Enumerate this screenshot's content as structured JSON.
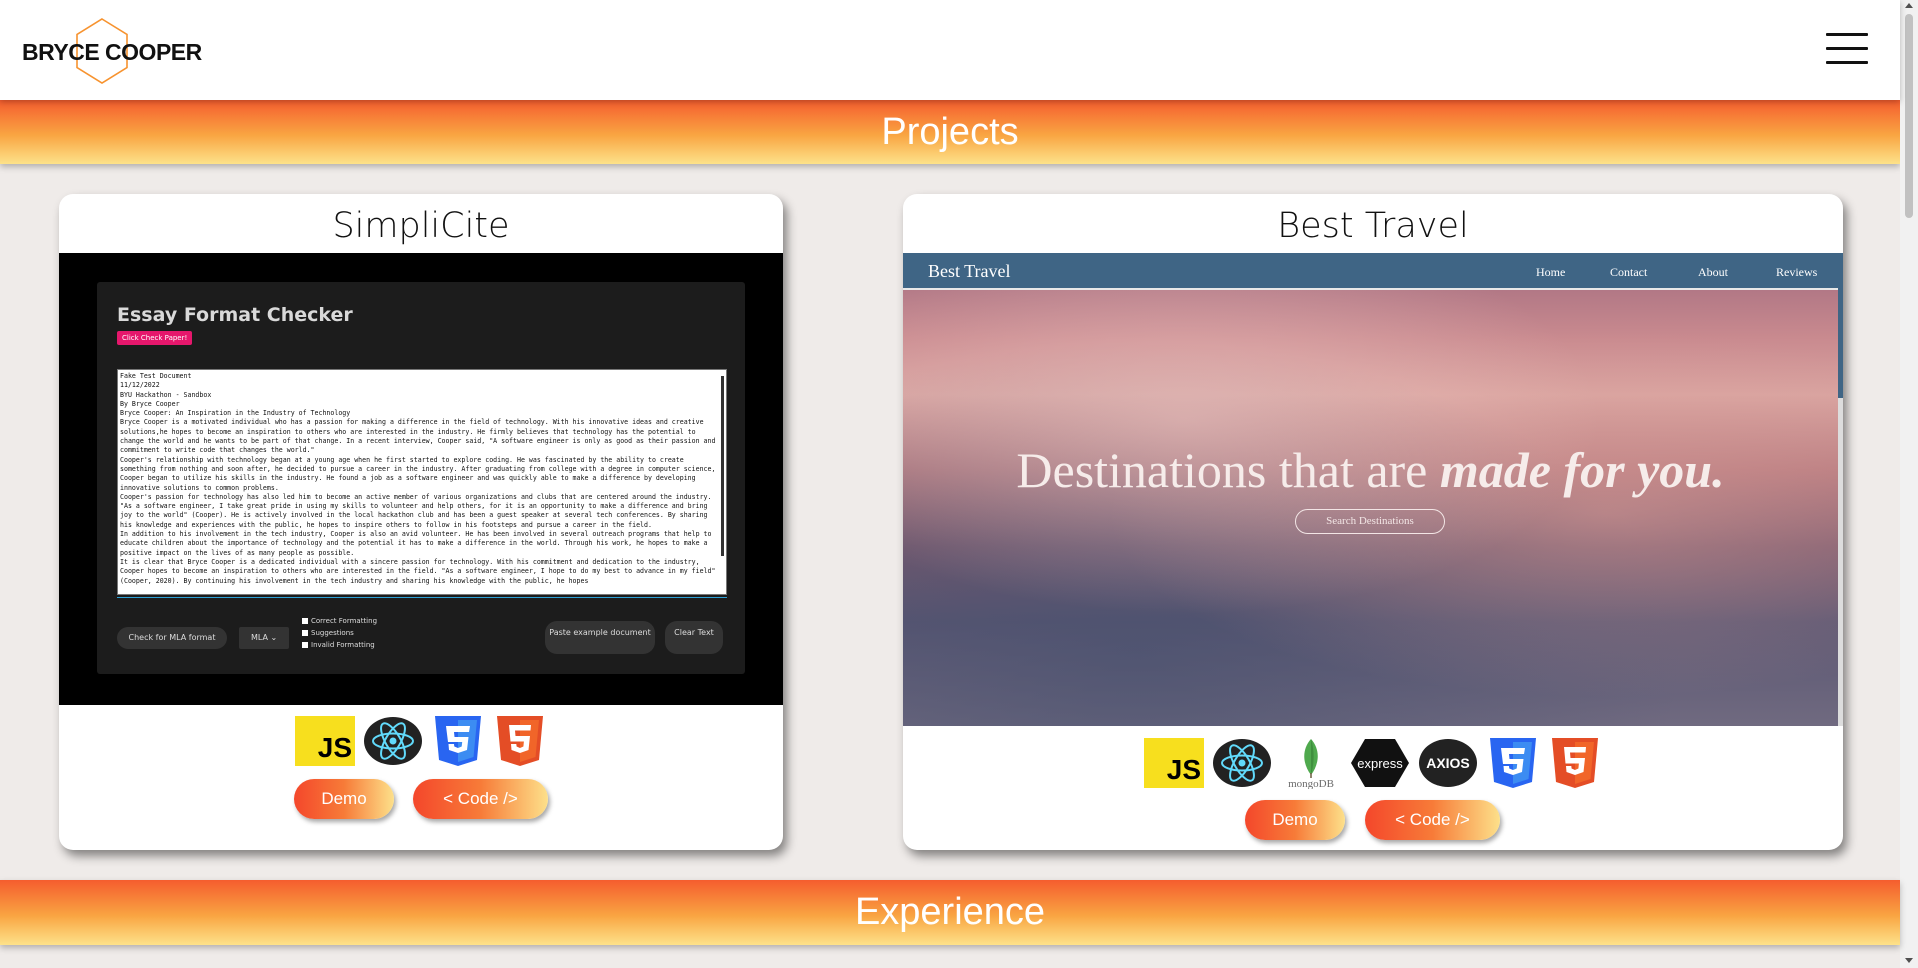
{
  "header": {
    "logo_text": "BRYCE COOPER",
    "menu_icon": "hamburger-menu-icon"
  },
  "sections": {
    "projects": "Projects",
    "experience": "Experience"
  },
  "projects": [
    {
      "title": "SimpliCite",
      "preview": {
        "heading": "Essay Format Checker",
        "check_button": "Click Check Paper!",
        "essay_text": "Fake Test Document\n11/12/2022\nBYU Hackathon - Sandbox\nBy Bryce Cooper\nBryce Cooper: An Inspiration in the Industry of Technology\nBryce Cooper is a motivated individual who has a passion for making a difference in the field of technology. With his innovative ideas and creative solutions,he hopes to become an inspiration to others who are interested in the industry. He firmly believes that technology has the potential to change the world and he wants to be part of that change. In a recent interview, Cooper said, \"A software engineer is only as good as their passion and commitment to write code that changes the world.\"\nCooper's relationship with technology began at a young age when he first started to explore coding. He was fascinated by the ability to create something from nothing and soon after, he decided to pursue a career in the industry. After graduating from college with a degree in computer science, Cooper began to utilize his skills in the industry. He found a job as a software engineer and was quickly able to make a difference by developing innovative solutions to common problems.\nCooper's passion for technology has also led him to become an active member of various organizations and clubs that are centered around the industry. \"As a software engineer, I take great pride in using my skills to volunteer and help others, for it is an opportunity to make a difference and bring joy to the world\" (Cooper). He is actively involved in the local hackathon club and has been a guest speaker at several tech conferences. By sharing his knowledge and experiences with the public, he hopes to inspire others to follow in his footsteps and pursue a career in the field.\nIn addition to his involvement in the tech industry, Cooper is also an avid volunteer. He has been involved in several outreach programs that help to educate children about the importance of technology and the potential it has to make a difference in the world. Through his work, he hopes to make a positive impact on the lives of as many people as possible.\nIt is clear that Bryce Cooper is a dedicated individual with a sincere passion for technology. With his commitment and dedication to the industry, Cooper hopes to become an inspiration to others who are interested in the field. \"As a software engineer, I hope to do my best to advance in my field\" (Cooper, 2020). By continuing his involvement in the tech industry and sharing his knowledge with the public, he hopes",
        "mla_button": "Check for MLA format",
        "format_select": "MLA",
        "checks": [
          "Correct Formatting",
          "Suggestions",
          "Invalid Formatting"
        ],
        "paste_button": "Paste example document",
        "clear_button": "Clear Text"
      },
      "tech_icons": [
        "javascript-icon",
        "react-icon",
        "css3-icon",
        "html5-icon"
      ],
      "demo_label": "Demo",
      "code_label": "< Code />"
    },
    {
      "title": "Best Travel",
      "preview": {
        "brand": "Best Travel",
        "nav": [
          "Home",
          "Contact",
          "About",
          "Reviews"
        ],
        "hero_plain": "Destinations that are ",
        "hero_emphasis": "made for you.",
        "search_button": "Search Destinations"
      },
      "tech_icons": [
        "javascript-icon",
        "react-icon",
        "mongodb-icon",
        "express-icon",
        "axios-icon",
        "css3-icon",
        "html5-icon"
      ],
      "tech_labels": {
        "mongodb": "mongoDB",
        "express": "express",
        "axios": "AXIOS"
      },
      "demo_label": "Demo",
      "code_label": "< Code />"
    }
  ],
  "colors": {
    "band_orange": "#f55d2e",
    "band_yellow": "#fde28a",
    "react": "#61dafb",
    "js": "#f7df1e",
    "css3": "#2965f1",
    "html5": "#e44d26",
    "mongodb_leaf": "#4fa94d",
    "travel_nav": "#3f6585"
  }
}
